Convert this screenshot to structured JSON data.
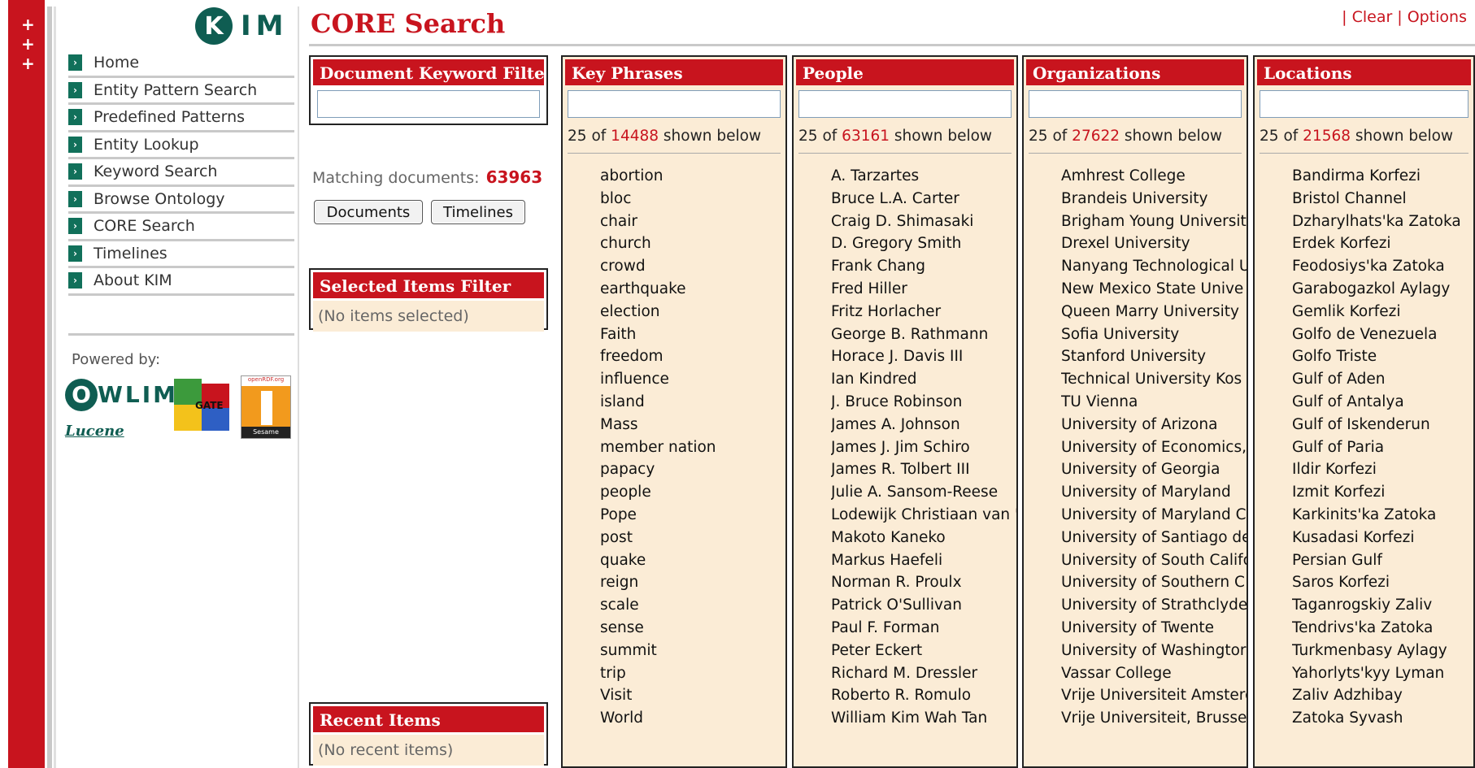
{
  "app": {
    "title": "CORE Search",
    "logo_text": "KIM"
  },
  "toplinks": {
    "clear": "Clear",
    "options": "Options"
  },
  "redstrip": {
    "plus": [
      "+",
      "+",
      "+"
    ]
  },
  "nav": {
    "items": [
      {
        "label": "Home"
      },
      {
        "label": "Entity Pattern Search"
      },
      {
        "label": "Predefined Patterns"
      },
      {
        "label": "Entity Lookup"
      },
      {
        "label": "Keyword Search"
      },
      {
        "label": "Browse Ontology"
      },
      {
        "label": "CORE Search"
      },
      {
        "label": "Timelines"
      },
      {
        "label": "About KIM"
      }
    ]
  },
  "powered": {
    "label": "Powered by:",
    "owlim_rest": "WLIM",
    "lucene": "Lucene",
    "gate": "GATE",
    "sesame_top": "openRDF.org",
    "sesame_bottom": "Sesame"
  },
  "doc_filter": {
    "title": "Document Keyword Filter",
    "value": ""
  },
  "matching": {
    "label": "Matching documents:",
    "count": "63963"
  },
  "buttons": {
    "documents": "Documents",
    "timelines": "Timelines"
  },
  "selected_filter": {
    "title": "Selected Items Filter",
    "empty": "(No items selected)"
  },
  "recent": {
    "title": "Recent Items",
    "empty": "(No recent items)"
  },
  "columns": [
    {
      "title": "Key Phrases",
      "shown": "25",
      "of": "of",
      "total": "14488",
      "suffix": "shown below",
      "items": [
        "abortion",
        "bloc",
        "chair",
        "church",
        "crowd",
        "earthquake",
        "election",
        "Faith",
        "freedom",
        "influence",
        "island",
        "Mass",
        "member nation",
        "papacy",
        "people",
        "Pope",
        "post",
        "quake",
        "reign",
        "scale",
        "sense",
        "summit",
        "trip",
        "Visit",
        "World"
      ]
    },
    {
      "title": "People",
      "shown": "25",
      "of": "of",
      "total": "63161",
      "suffix": "shown below",
      "items": [
        "A. Tarzartes",
        "Bruce L.A. Carter",
        "Craig D. Shimasaki",
        "D. Gregory Smith",
        "Frank Chang",
        "Fred Hiller",
        "Fritz Horlacher",
        "George B. Rathmann",
        "Horace J. Davis III",
        "Ian Kindred",
        "J. Bruce Robinson",
        "James A. Johnson",
        "James J. Jim Schiro",
        "James R. Tolbert III",
        "Julie A. Sansom-Reese",
        "Lodewijk Christiaan van '",
        "Makoto Kaneko",
        "Markus Haefeli",
        "Norman R. Proulx",
        "Patrick O'Sullivan",
        "Paul F. Forman",
        "Peter Eckert",
        "Richard M. Dressler",
        "Roberto R. Romulo",
        "William Kim Wah Tan"
      ]
    },
    {
      "title": "Organizations",
      "shown": "25",
      "of": "of",
      "total": "27622",
      "suffix": "shown below",
      "items": [
        "Amhrest College",
        "Brandeis University",
        "Brigham Young Universit",
        "Drexel University",
        "Nanyang Technological U",
        "New Mexico State Unive",
        "Queen Marry University",
        "Sofia University",
        "Stanford University",
        "Technical University Kos",
        "TU Vienna",
        "University of Arizona",
        "University of Economics,",
        "University of Georgia",
        "University of Maryland",
        "University of Maryland C",
        "University of Santiago de",
        "University of South Califc",
        "University of Southern C",
        "University of Strathclyde",
        "University of Twente",
        "University of Washingtor",
        "Vassar College",
        "Vrije Universiteit Amsterc",
        "Vrije Universiteit, Brusse"
      ]
    },
    {
      "title": "Locations",
      "shown": "25",
      "of": "of",
      "total": "21568",
      "suffix": "shown below",
      "items": [
        "Bandirma Korfezi",
        "Bristol Channel",
        "Dzharylhats'ka Zatoka",
        "Erdek Korfezi",
        "Feodosiys'ka Zatoka",
        "Garabogazkol Aylagy",
        "Gemlik Korfezi",
        "Golfo de Venezuela",
        "Golfo Triste",
        "Gulf of Aden",
        "Gulf of Antalya",
        "Gulf of Iskenderun",
        "Gulf of Paria",
        "Ildir Korfezi",
        "Izmit Korfezi",
        "Karkinits'ka Zatoka",
        "Kusadasi Korfezi",
        "Persian Gulf",
        "Saros Korfezi",
        "Taganrogskiy Zaliv",
        "Tendrivs'ka Zatoka",
        "Turkmenbasy Aylagy",
        "Yahorlyts'kyy Lyman",
        "Zaliv Adzhibay",
        "Zatoka Syvash"
      ]
    }
  ]
}
